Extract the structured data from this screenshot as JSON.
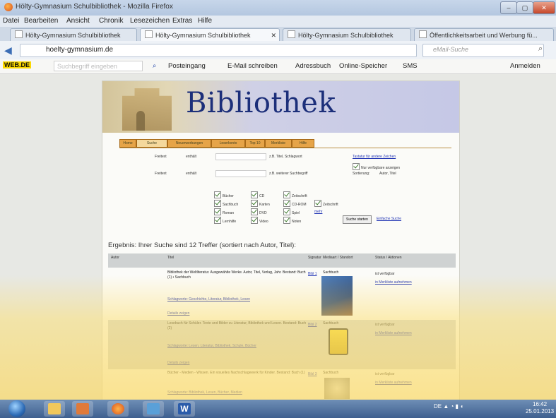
{
  "window": {
    "title": "Hölty-Gymnasium Schulbibliothek - Mozilla Firefox",
    "buttons": {
      "minimize": "–",
      "maximize": "▢",
      "close": "✕"
    }
  },
  "menu": [
    "Datei",
    "Bearbeiten",
    "Ansicht",
    "Chronik",
    "Lesezeichen",
    "Extras",
    "Hilfe"
  ],
  "tabs": [
    {
      "label": "Hölty-Gymnasium Schulbibliothek",
      "active": false
    },
    {
      "label": "Hölty-Gymnasium Schulbibliothek",
      "active": true
    },
    {
      "label": "Hölty-Gymnasium Schulbibliothek",
      "active": false
    },
    {
      "label": "Öffentlichkeitsarbeit und Werbung fü...",
      "active": false
    }
  ],
  "nav": {
    "url": "hoelty-gymnasium.de",
    "search_placeholder": "eMail-Suche"
  },
  "webde": {
    "logo": "WEB.DE",
    "search_placeholder": "Suchbegriff eingeben",
    "items": [
      "Posteingang",
      "E-Mail schreiben",
      "Adressbuch",
      "Online-Speicher",
      "SMS",
      "Anmelden"
    ]
  },
  "page": {
    "banner_title": "Bibliothek",
    "nav_tabs": [
      "Home",
      "Suche",
      "Neuerwerbungen",
      "Leserkonto",
      "Top 10",
      "Merkliste",
      "Hilfe"
    ],
    "search": {
      "row1_label": "Freitext",
      "row1_op": "enthält",
      "row1_hint": "z.B. Titel, Schlagwort",
      "row1_link": "Tastatur für andere Zeichen",
      "row2_label": "Freitext",
      "row2_op": "enthält",
      "row2_hint": "z.B. weiterer Suchbegriff",
      "check_available": "Nur verfügbare anzeigen",
      "sort_label": "Sortierung:",
      "sort_value": "Autor, Titel"
    },
    "media_types": [
      "Bücher",
      "CD",
      "Zeitschrift",
      "Sachbuch",
      "Karten",
      "CD-ROM",
      "Zeitschrift",
      "Roman",
      "DVD",
      "Spiel",
      "Lernhilfe",
      "Video",
      "Noten",
      "mehr"
    ],
    "buttons": {
      "search": "Suche starten",
      "reset": "Einfache Suche"
    },
    "result_text": "Ergebnis: Ihrer Suche sind 12 Treffer (sortiert nach Autor, Titel):",
    "table_headers": [
      "Autor",
      "Titel",
      "Signatur",
      "Mediaart / Standort",
      "Status / Aktionen"
    ],
    "results": [
      {
        "title": "Bibliothek der Weltliteratur. Ausgewählte Werke. Autor, Titel, Verlag, Jahr. Bestand: Buch (1) • Sachbuch",
        "keywords": "Schlagworte: Geschichte, Literatur, Bibliothek, Lesen",
        "more": "Details zeigen",
        "signature": "Bibl 1",
        "type": "Sachbuch",
        "status": "ist verfügbar",
        "action": "in Merkliste aufnehmen"
      },
      {
        "title": "Lesebuch für Schüler. Texte und Bilder zu Literatur, Bibliothek und Lesen. Bestand: Buch (2)",
        "keywords": "Schlagworte: Lesen, Literatur, Bibliothek, Schule, Bücher",
        "more": "Details zeigen",
        "signature": "Bibl 2",
        "type": "Sachbuch",
        "status": "ist verfügbar",
        "action": "in Merkliste aufnehmen"
      },
      {
        "title": "Bücher - Medien - Wissen. Ein visuelles Nachschlagewerk für Kinder. Bestand: Buch (1)",
        "keywords": "Schlagworte: Bibliothek, Lesen, Bücher, Medien",
        "more": "",
        "signature": "Bibl 3",
        "type": "Sachbuch",
        "status": "ist verfügbar",
        "action": "in Merkliste aufnehmen"
      }
    ]
  },
  "taskbar": {
    "lang": "DE",
    "time": "16:42",
    "date": "25.01.2013"
  },
  "colors": {
    "banner_title": "#1c2f7a",
    "nav_tab": "#e6a448",
    "link": "#2336b5"
  }
}
